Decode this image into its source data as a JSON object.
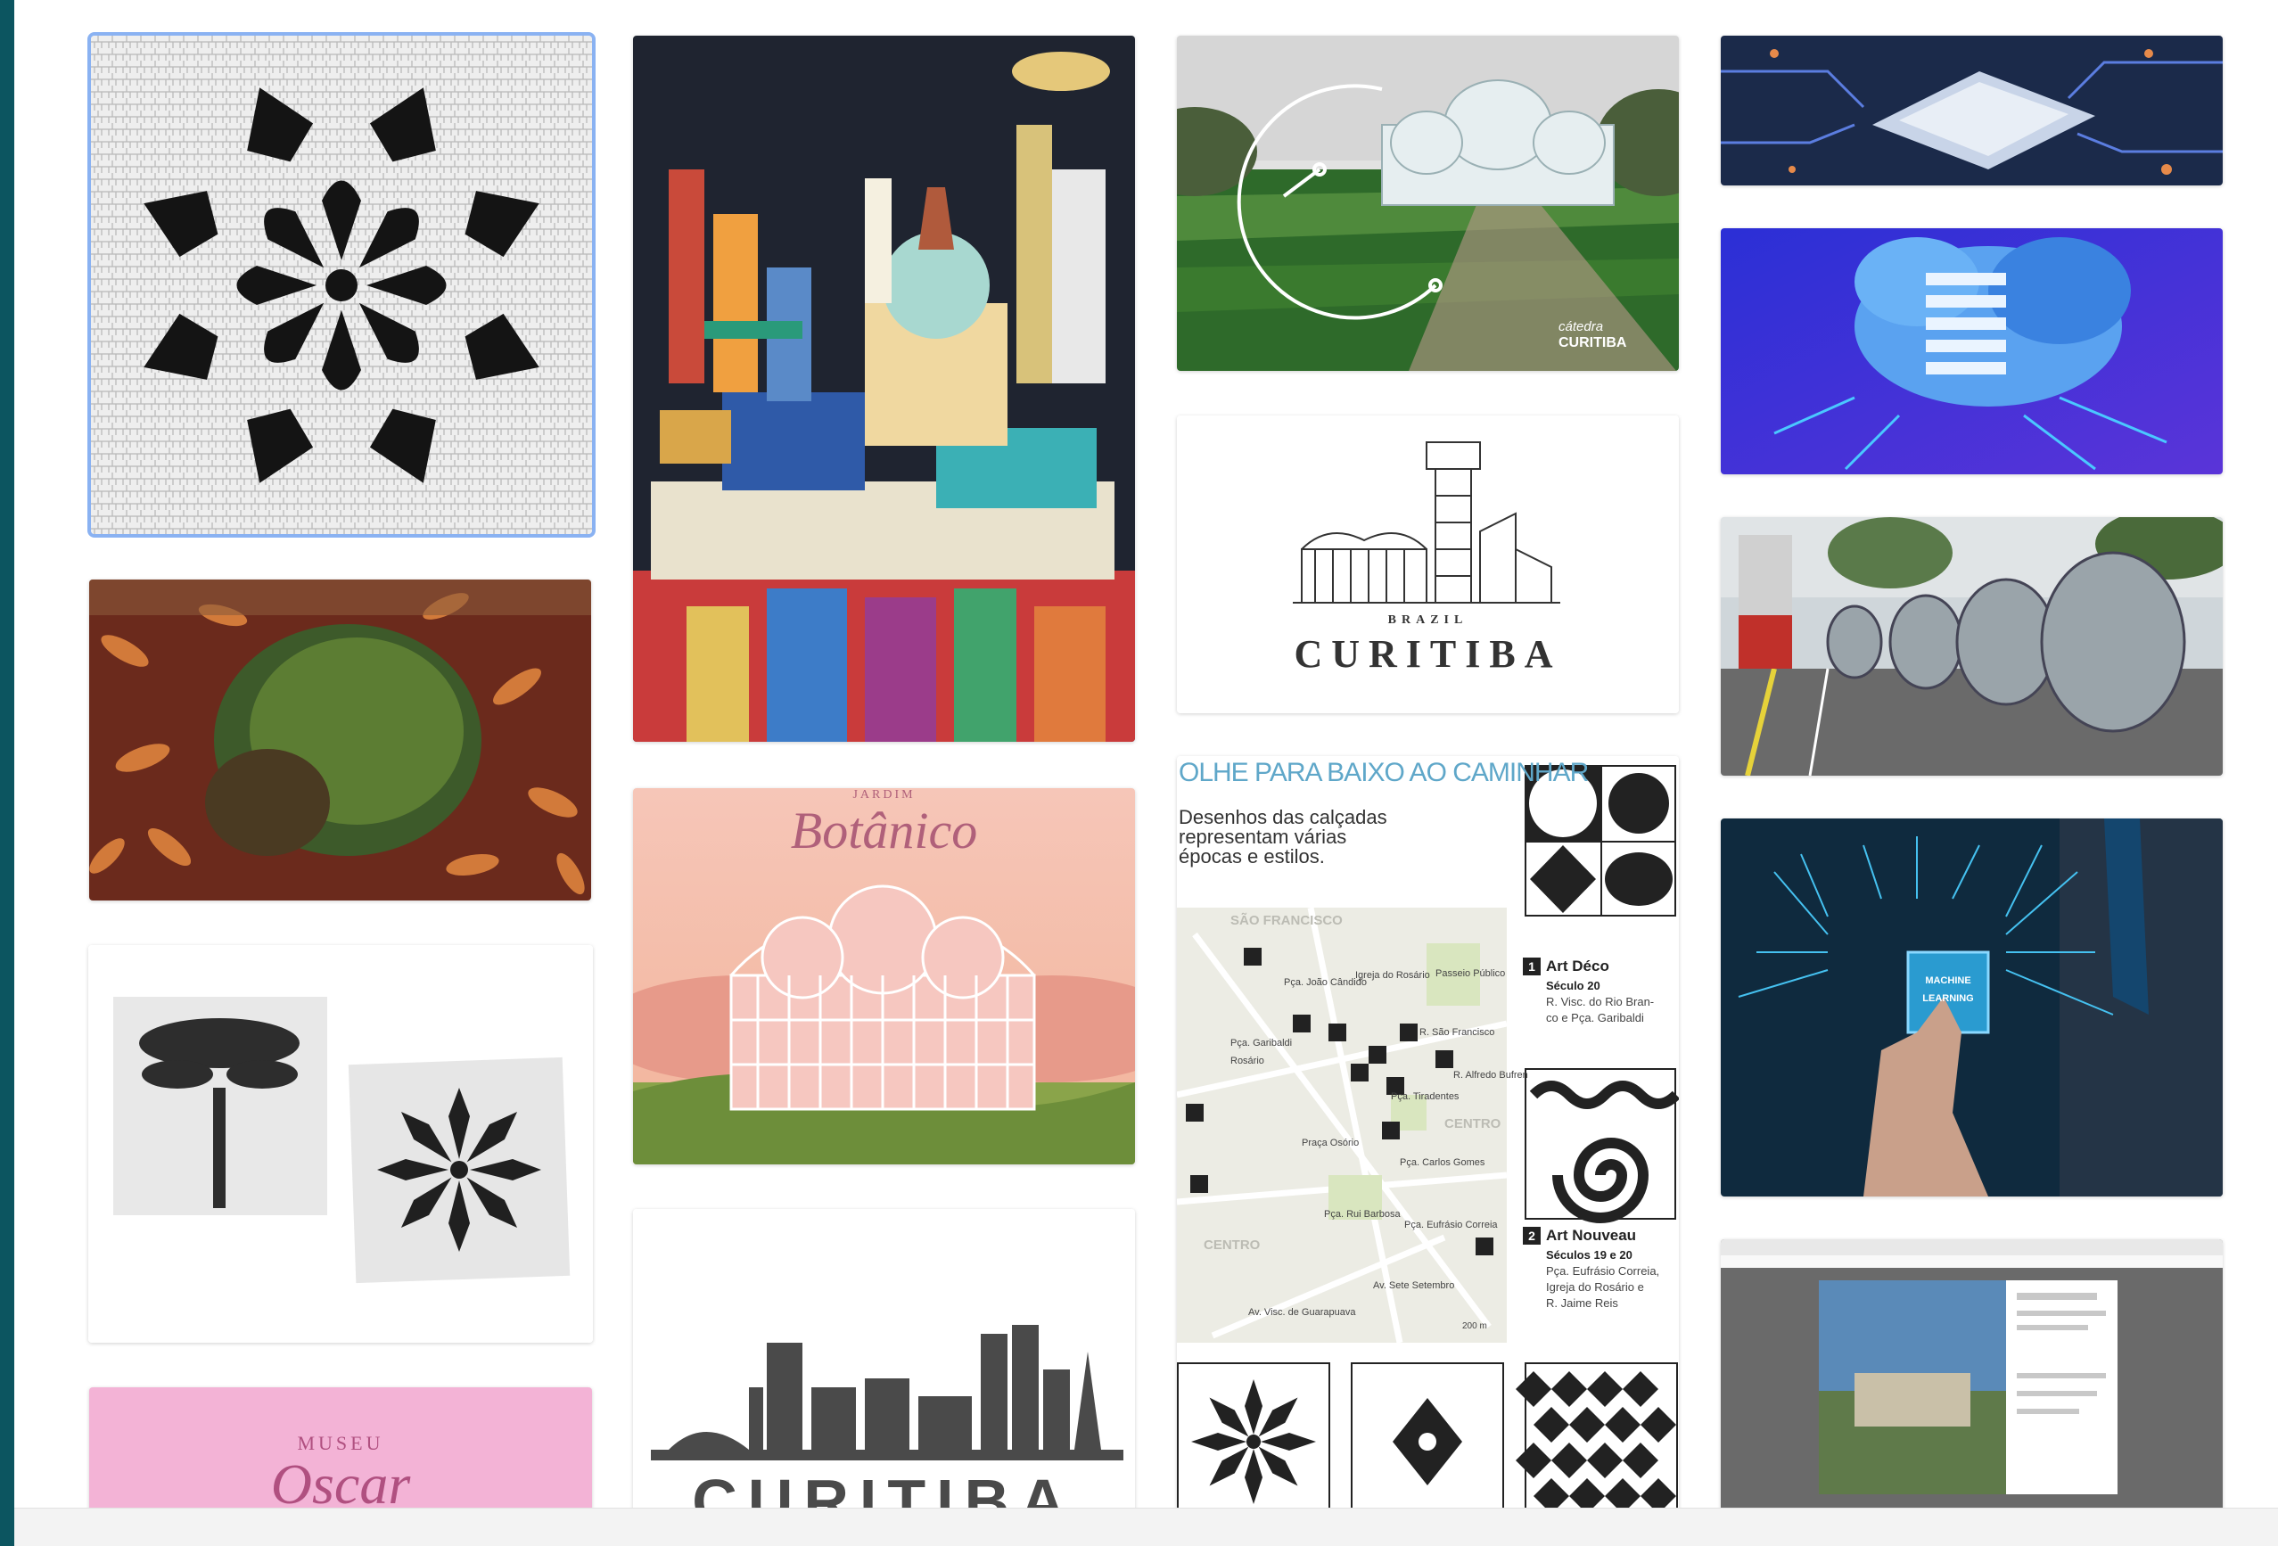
{
  "board": {
    "tiles": [
      {
        "name": "Pavement mosaic flower"
      },
      {
        "name": "Curitiba city illustration"
      },
      {
        "name": "Jardim Botânico with circuit overlay",
        "logo_line1": "cátedra",
        "logo_line2": "CURITIBA"
      },
      {
        "name": "Computer chip"
      },
      {
        "name": "Pinecone and pinhões"
      },
      {
        "name": "Brazil Curitiba logo",
        "subtitle": "BRAZIL",
        "title": "CURITIBA"
      },
      {
        "name": "Cloud data isometric"
      },
      {
        "name": "Tube bus station"
      },
      {
        "name": "Jardim Botânico poster",
        "kicker": "JARDIM",
        "title": "Botânico"
      },
      {
        "name": "Olhe para baixo ao caminhar map",
        "headline": "OLHE PARA BAIXO AO CAMINHAR",
        "intro": [
          "Desenhos das calçadas",
          "representam várias",
          "épocas e estilos."
        ],
        "map_labels": [
          "SÃO FRANCISCO",
          "Pça. João Cândido",
          "Igreja do Rosário",
          "Passeio Público",
          "Pça. Garibaldi",
          "Rosário",
          "R. São Francisco",
          "Pça. Tiradentes",
          "R. Alfredo Bufren",
          "CENTRO",
          "Praça Osório",
          "Pça. Carlos Gomes",
          "Pça. Rui Barbosa",
          "Pça. Eufrásio Correia",
          "CENTRO",
          "Av. Sete Setembro",
          "Av. Visc. de Guarapuava",
          "200 m"
        ],
        "legend": [
          {
            "num": "1",
            "style": "Art Déco",
            "century": "Século 20",
            "places": [
              "R. Visc. do Rio Bran-",
              "co e Pça. Garibaldi"
            ]
          },
          {
            "num": "2",
            "style": "Art Nouveau",
            "century": "Séculos 19 e 20",
            "places": [
              "Pça. Eufrásio Correia,",
              "Igreja do Rosário e",
              "R. Jaime Reis"
            ]
          }
        ]
      },
      {
        "name": "Pavement mosaic tiles"
      },
      {
        "name": "Machine learning hand",
        "chip_line1": "MACHINE",
        "chip_line2": "LEARNING"
      },
      {
        "name": "Museu Oscar Niemeyer",
        "kicker": "MUSEU",
        "title": "Oscar"
      },
      {
        "name": "Curitiba skyline logo",
        "title": "CURITIBA"
      },
      {
        "name": "Browser screenshot"
      }
    ]
  }
}
